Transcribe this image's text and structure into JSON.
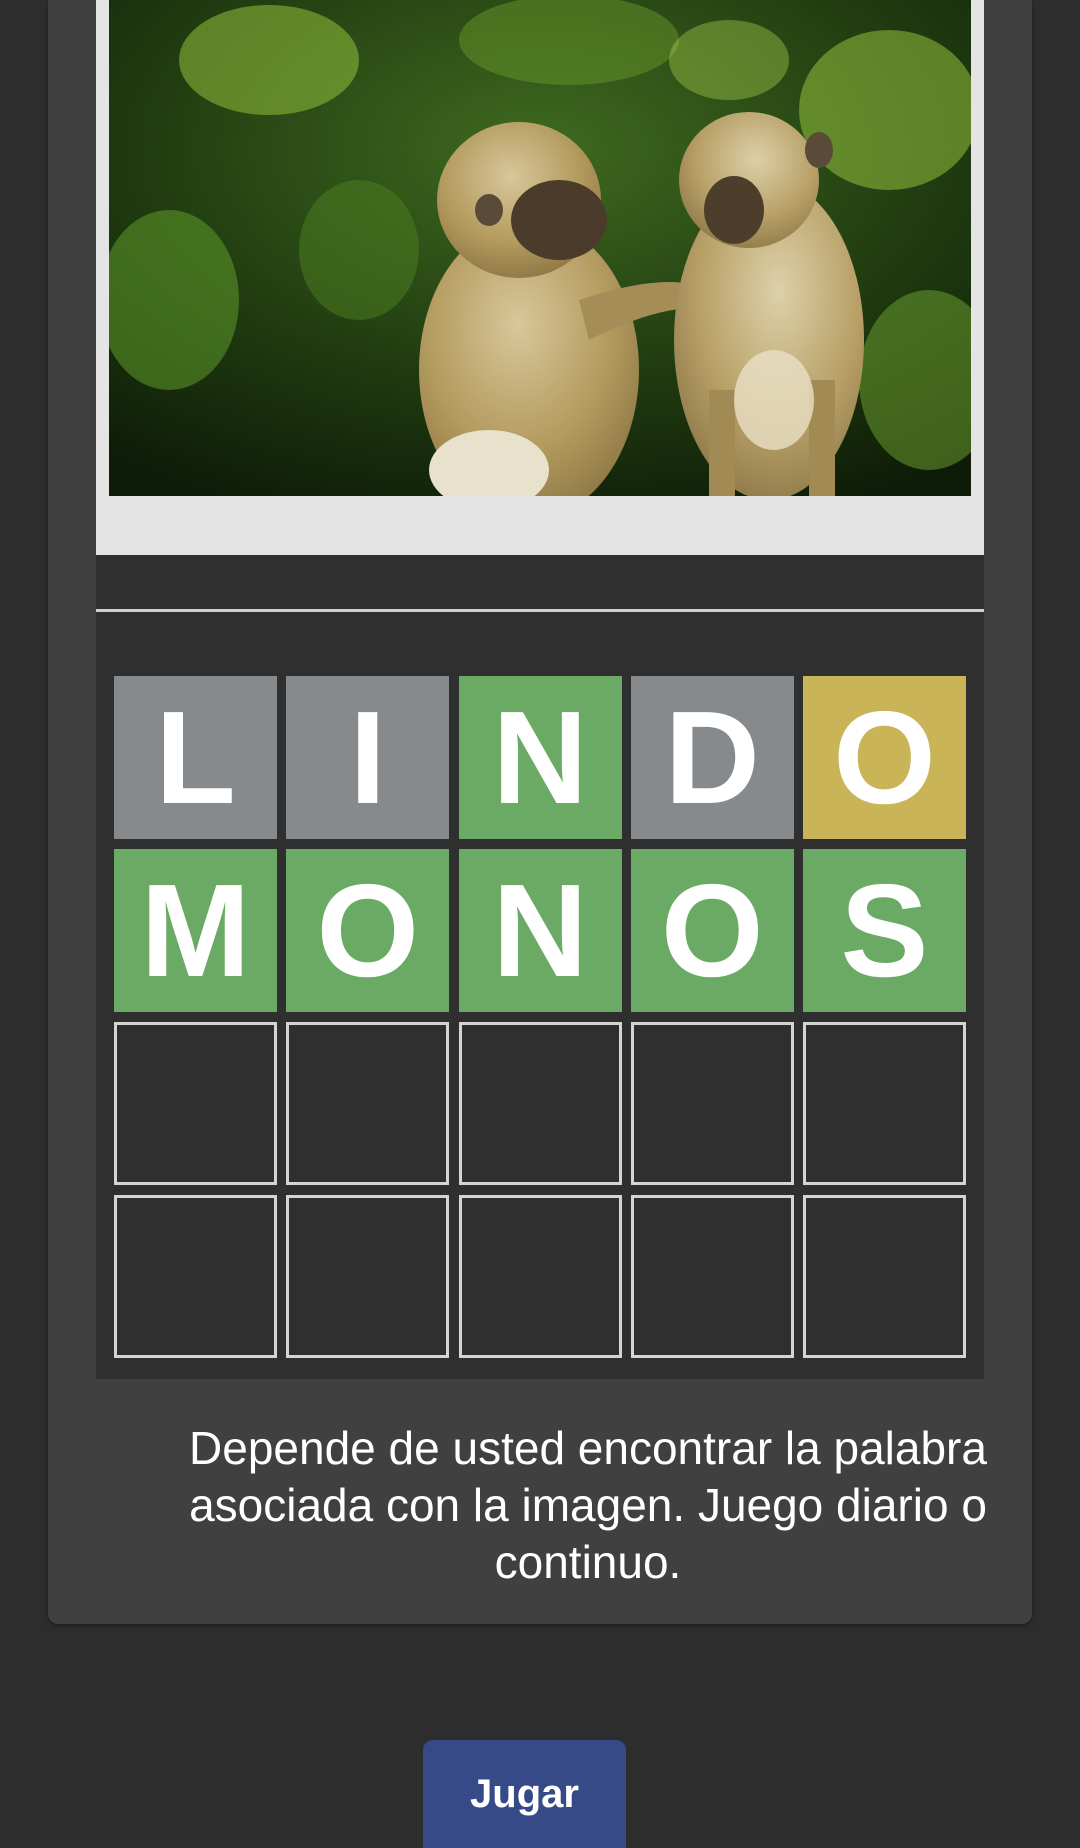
{
  "image": {
    "subject": "two monkeys grooming"
  },
  "board": {
    "rows": [
      [
        {
          "letter": "L",
          "state": "absent"
        },
        {
          "letter": "I",
          "state": "absent"
        },
        {
          "letter": "N",
          "state": "correct"
        },
        {
          "letter": "D",
          "state": "absent"
        },
        {
          "letter": "O",
          "state": "present"
        }
      ],
      [
        {
          "letter": "M",
          "state": "correct"
        },
        {
          "letter": "O",
          "state": "correct"
        },
        {
          "letter": "N",
          "state": "correct"
        },
        {
          "letter": "O",
          "state": "correct"
        },
        {
          "letter": "S",
          "state": "correct"
        }
      ],
      [
        {
          "letter": "",
          "state": "empty"
        },
        {
          "letter": "",
          "state": "empty"
        },
        {
          "letter": "",
          "state": "empty"
        },
        {
          "letter": "",
          "state": "empty"
        },
        {
          "letter": "",
          "state": "empty"
        }
      ],
      [
        {
          "letter": "",
          "state": "empty"
        },
        {
          "letter": "",
          "state": "empty"
        },
        {
          "letter": "",
          "state": "empty"
        },
        {
          "letter": "",
          "state": "empty"
        },
        {
          "letter": "",
          "state": "empty"
        }
      ]
    ]
  },
  "description": "Depende de usted encontrar la palabra asociada con la imagen. Juego diario o continuo.",
  "play_button": {
    "label": "Jugar"
  },
  "colors": {
    "absent": "#878a8c",
    "present": "#c9b458",
    "correct": "#6aaa64",
    "button": "#354a86"
  }
}
